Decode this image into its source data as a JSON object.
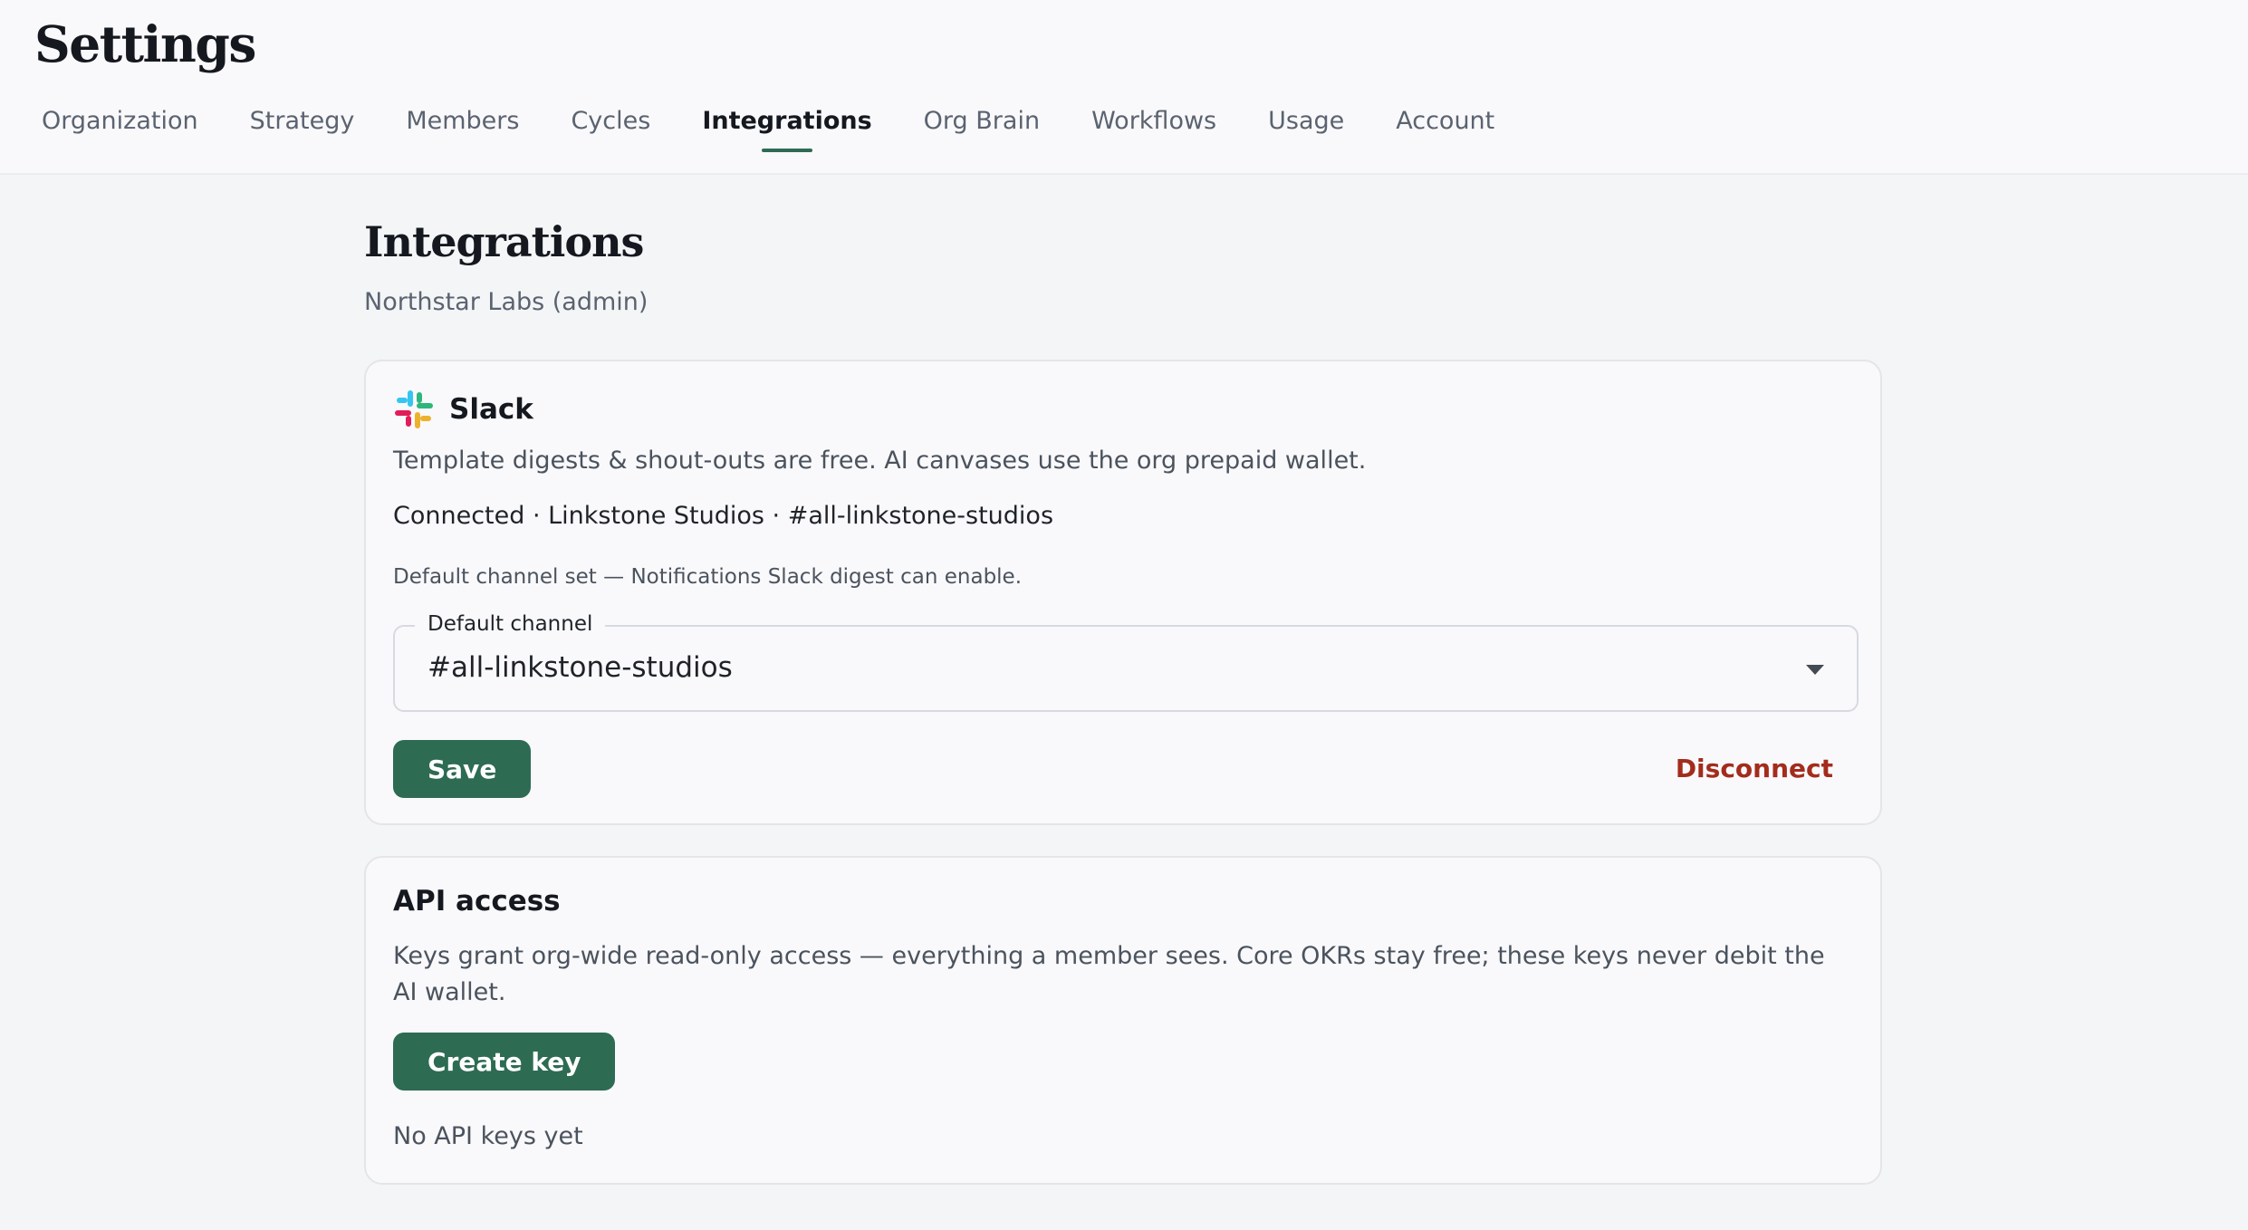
{
  "header": {
    "title": "Settings",
    "tabs": [
      {
        "label": "Organization"
      },
      {
        "label": "Strategy"
      },
      {
        "label": "Members"
      },
      {
        "label": "Cycles"
      },
      {
        "label": "Integrations",
        "active": true
      },
      {
        "label": "Org Brain"
      },
      {
        "label": "Workflows"
      },
      {
        "label": "Usage"
      },
      {
        "label": "Account"
      }
    ]
  },
  "page": {
    "title": "Integrations",
    "subtitle": "Northstar Labs (admin)"
  },
  "slack": {
    "icon": "slack-logo-icon",
    "title": "Slack",
    "description": "Template digests & shout-outs are free. AI canvases use the org prepaid wallet.",
    "status": "Connected · Linkstone Studios · #all-linkstone-studios",
    "hint": "Default channel set — Notifications Slack digest can enable.",
    "select": {
      "label": "Default channel",
      "value": "#all-linkstone-studios"
    },
    "save_label": "Save",
    "disconnect_label": "Disconnect"
  },
  "api": {
    "title": "API access",
    "description": "Keys grant org-wide read-only access — everything a member sees. Core OKRs stay free; these keys never debit the AI wallet.",
    "create_label": "Create key",
    "empty_label": "No API keys yet"
  },
  "colors": {
    "accent": "#2e6b53",
    "danger": "#a32c1c",
    "background": "#f4f5f7",
    "card": "#f9f9fb"
  }
}
